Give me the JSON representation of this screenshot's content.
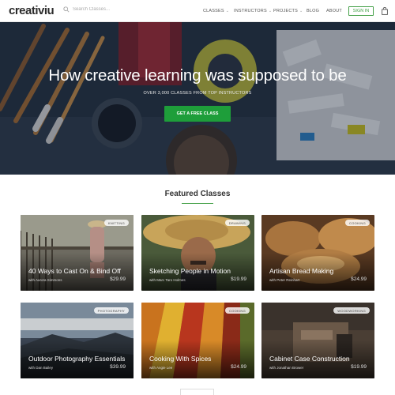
{
  "header": {
    "logo": "creativiu",
    "search_placeholder": "Search Classes...",
    "nav": [
      {
        "label": "CLASSES",
        "dropdown": true
      },
      {
        "label": "INSTRUCTORS",
        "dropdown": true
      },
      {
        "label": "PROJECTS",
        "dropdown": true
      },
      {
        "label": "BLOG",
        "dropdown": false
      },
      {
        "label": "ABOUT",
        "dropdown": false
      }
    ],
    "signin_label": "SIGN IN",
    "cart_icon": "shopping-bag-icon"
  },
  "hero": {
    "title": "How creative learning was supposed to be",
    "subtitle": "OVER 3,000 CLASSES FROM TOP INSTRUCTORS",
    "cta_label": "GET A FREE CLASS"
  },
  "featured": {
    "title": "Featured Classes",
    "cards": [
      {
        "badge": "KNITTING",
        "title": "40 Ways to Cast On & Bind Off",
        "author": "with Aurora Simmons",
        "price": "$29.99"
      },
      {
        "badge": "DRAWING",
        "title": "Sketching People in Motion",
        "author": "with Marc Taro Holmes",
        "price": "$19.99"
      },
      {
        "badge": "COOKING",
        "title": "Artisan Bread Making",
        "author": "with Peter Reinhart",
        "price": "$24.99"
      },
      {
        "badge": "PHOTOGRAPHY",
        "title": "Outdoor Photography Essentials",
        "author": "with Dan Bailey",
        "price": "$39.99"
      },
      {
        "badge": "COOKING",
        "title": "Cooking With Spices",
        "author": "with Angie Lee",
        "price": "$24.99"
      },
      {
        "badge": "WOODWORKING",
        "title": "Cabinet Case Construction",
        "author": "with Jonathan Brower",
        "price": "$19.99"
      }
    ]
  },
  "colors": {
    "accent": "#1e9e3a",
    "signin": "#43a047"
  }
}
